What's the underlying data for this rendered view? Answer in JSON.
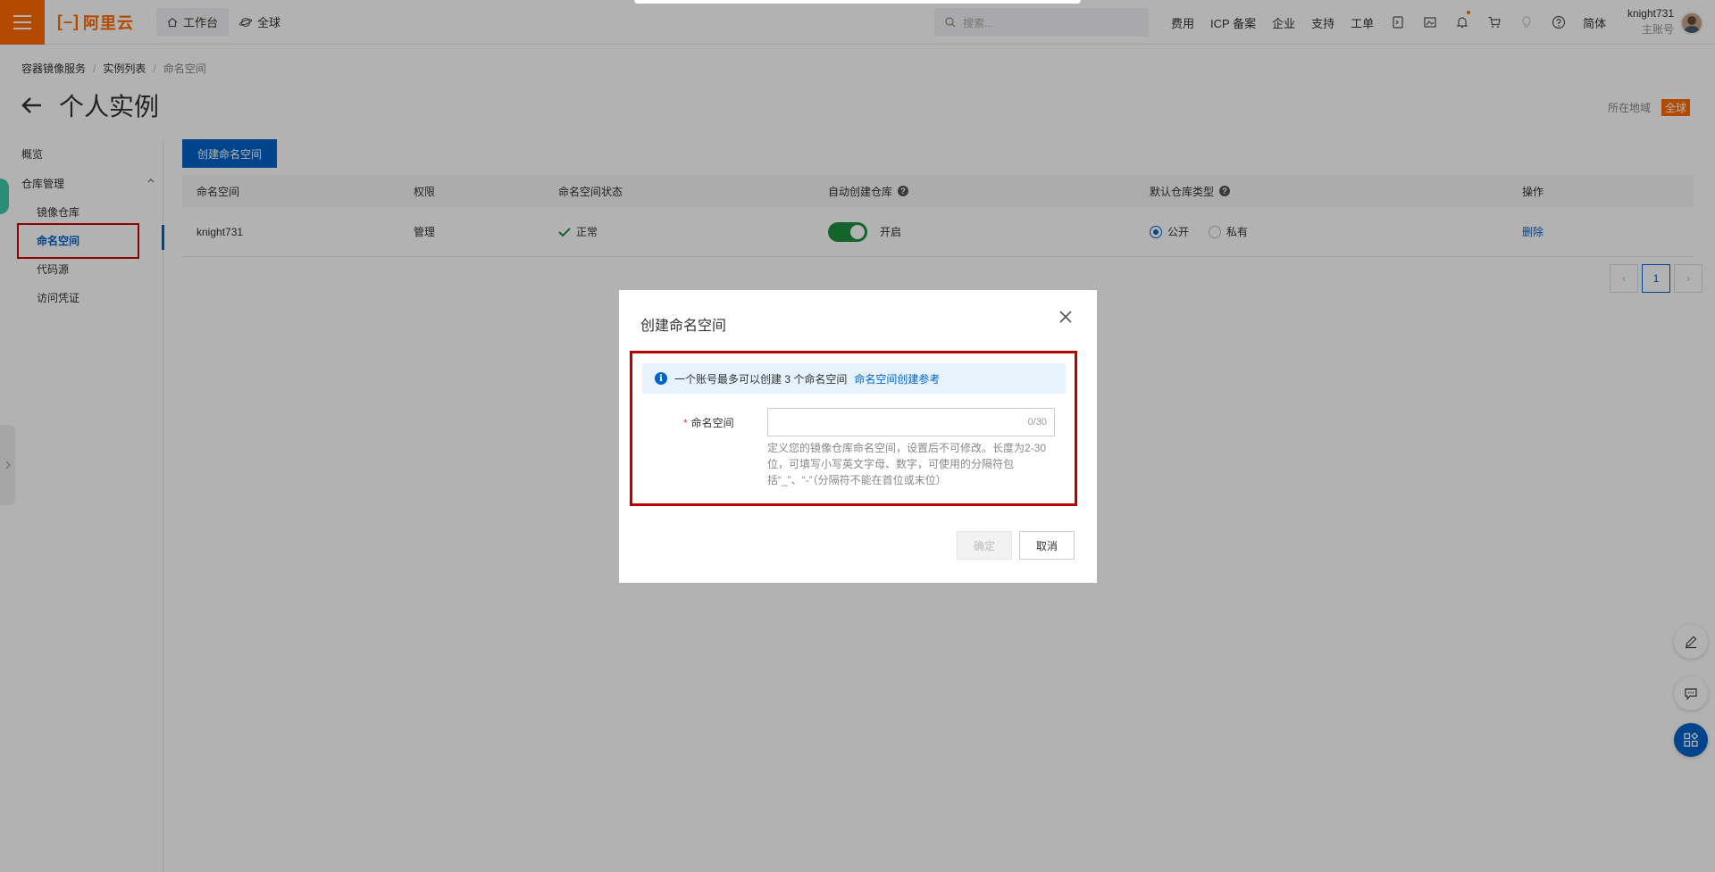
{
  "topbar": {
    "brand": "阿里云",
    "workbench": "工作台",
    "region": "全球",
    "search_placeholder": "搜索...",
    "links": [
      "费用",
      "ICP 备案",
      "企业",
      "支持",
      "工单"
    ],
    "lang": "简体",
    "user_name": "knight731",
    "user_role": "主账号",
    "accent_color": "#ff6a00"
  },
  "breadcrumb": [
    "容器镜像服务",
    "实例列表",
    "命名空间"
  ],
  "page_title": "个人实例",
  "region_label": "所在地域",
  "region_value": "全球",
  "sidebar": {
    "overview": "概览",
    "group": "仓库管理",
    "items": [
      "镜像仓库",
      "命名空间",
      "代码源",
      "访问凭证"
    ],
    "active": "命名空间"
  },
  "main": {
    "create_button": "创建命名空间",
    "columns": [
      "命名空间",
      "权限",
      "命名空间状态",
      "自动创建仓库",
      "默认仓库类型",
      "操作"
    ],
    "rows": [
      {
        "namespace": "knight731",
        "permission": "管理",
        "status": "正常",
        "auto_create_state": "开启",
        "auto_create_on": true,
        "repo_type_public": "公开",
        "repo_type_private": "私有",
        "selected_repo_type": "公开",
        "action": "删除"
      }
    ],
    "pagination": {
      "current_page": "1"
    }
  },
  "modal": {
    "title": "创建命名空间",
    "info_text": "一个账号最多可以创建 3 个命名空间",
    "info_link": "命名空间创建参考",
    "field_label": "命名空间",
    "field_value": "",
    "field_counter": "0/30",
    "field_help": "定义您的镜像仓库命名空间，设置后不可修改。长度为2-30位，可填写小写英文字母、数字，可使用的分隔符包括“_”、“-”（分隔符不能在首位或末位）",
    "ok_label": "确定",
    "cancel_label": "取消"
  },
  "colors": {
    "primary": "#0064c8",
    "highlight_box": "#b00000",
    "success": "#1e8e3e"
  }
}
